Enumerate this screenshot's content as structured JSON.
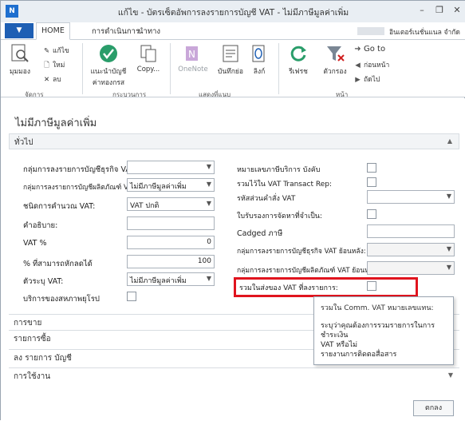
{
  "window": {
    "title": "แก้ไข - บัตรเซ็ตอัพการลงรายการบัญชี VAT - ไม่มีภาษีมูลค่าเพิ่ม",
    "app_icon": "N",
    "minimize": "–",
    "restore": "❐",
    "close": "✕"
  },
  "ribbon_tabs": {
    "file": "▼",
    "home": "HOME",
    "actions": "การดำเนินการ",
    "navigate": "นำทาง",
    "company": "อินเตอร์เนชั่นแนล จำกัด"
  },
  "ribbon": {
    "groups": {
      "manage": "จัดการ",
      "process": "กระบวนการ",
      "show_attached": "แสดงที่แนบ",
      "page": "หน้า"
    },
    "view": "มุมมอง",
    "edit": "แก้ไข",
    "new": "ใหม่",
    "delete": "ลบ",
    "suggest_accounts": "แนะนำบัญชีค่าทองกรส",
    "copy": "Copy...",
    "onenote": "OneNote",
    "notes": "บันทึกย่อ",
    "links": "ลิงก์",
    "refresh": "รีเฟรช",
    "filter": "ตัวกรอง",
    "goto": "Go to",
    "previous": "ก่อนหน้า",
    "next": "ถัดไป"
  },
  "page": {
    "title": "ไม่มีภาษีมูลค่าเพิ่ม",
    "general_tab": "ทั่วไป"
  },
  "fields_left": {
    "vat_bus_posting_group_label": "กลุ่มการลงรายการบัญชีธุรกิจ VAT:",
    "vat_bus_posting_group_value": "",
    "vat_prod_posting_group_label": "กลุ่มการลงรายการบัญชีผลิตภัณฑ์ VAT:",
    "vat_prod_posting_group_value": "ไม่มีภาษีมูลค่าเพิ่ม",
    "vat_calc_type_label": "ชนิดการคำนวณ VAT:",
    "vat_calc_type_value": "VAT ปกติ",
    "description_label": "คำอธิบาย:",
    "description_value": "",
    "vat_pct_label": "VAT %",
    "vat_pct_value": "0",
    "deductible_pct_label": "% ที่สามารถหักลดได้",
    "deductible_pct_value": "100",
    "vat_id_label": "ตัวระบุ VAT:",
    "vat_id_value": "ไม่มีภาษีมูลค่าเพิ่ม",
    "eu_service_label": "บริการของสหภาพยุโรป"
  },
  "fields_right": {
    "service_note_label": "หมายเลขภาษีบริการ บังคับ",
    "vat_transact_rep_label": "รวมไว้ใน VAT Transact Rep:",
    "vat_clause_code_label": "รหัสส่วนคำสั่ง VAT",
    "vat_clause_code_value": "",
    "cert_required_label": "ใบรับรองการจัดหาที่จำเป็น:",
    "caged_tax_label": "Cadged ภาษี",
    "caged_tax_value": "",
    "reverse_bus_label": "กลุ่มการลงรายการบัญชีธุรกิจ VAT ย้อนหลัง:",
    "reverse_bus_value": "",
    "reverse_prod_label": "กลุ่มการลงรายการบัญชีผลิตภัณฑ์ VAT ย้อนหลัง:",
    "reverse_prod_value": "",
    "include_in_vat_report_label": "รวมในส่งของ VAT ที่ลงรายการ:"
  },
  "tooltip": {
    "title": "รวมใน Comm. VAT หมายเลขแทน:",
    "body_1": "ระบุว่าคุณต้องการรวมรายการในการชำระเงิน",
    "body_2": "VAT หรือไม่",
    "body_3": "รายงานการติดตอสื่อสาร"
  },
  "fasttabs": {
    "sales": "การขาย",
    "purchases": "รายการซื้อ",
    "posting_accounts": "ลง รายการ บัญชี",
    "usage": "การใช้งาน"
  },
  "buttons": {
    "ok": "ตกลง"
  },
  "colors": {
    "accent": "#1e5fb4",
    "highlight": "#e0141e"
  }
}
